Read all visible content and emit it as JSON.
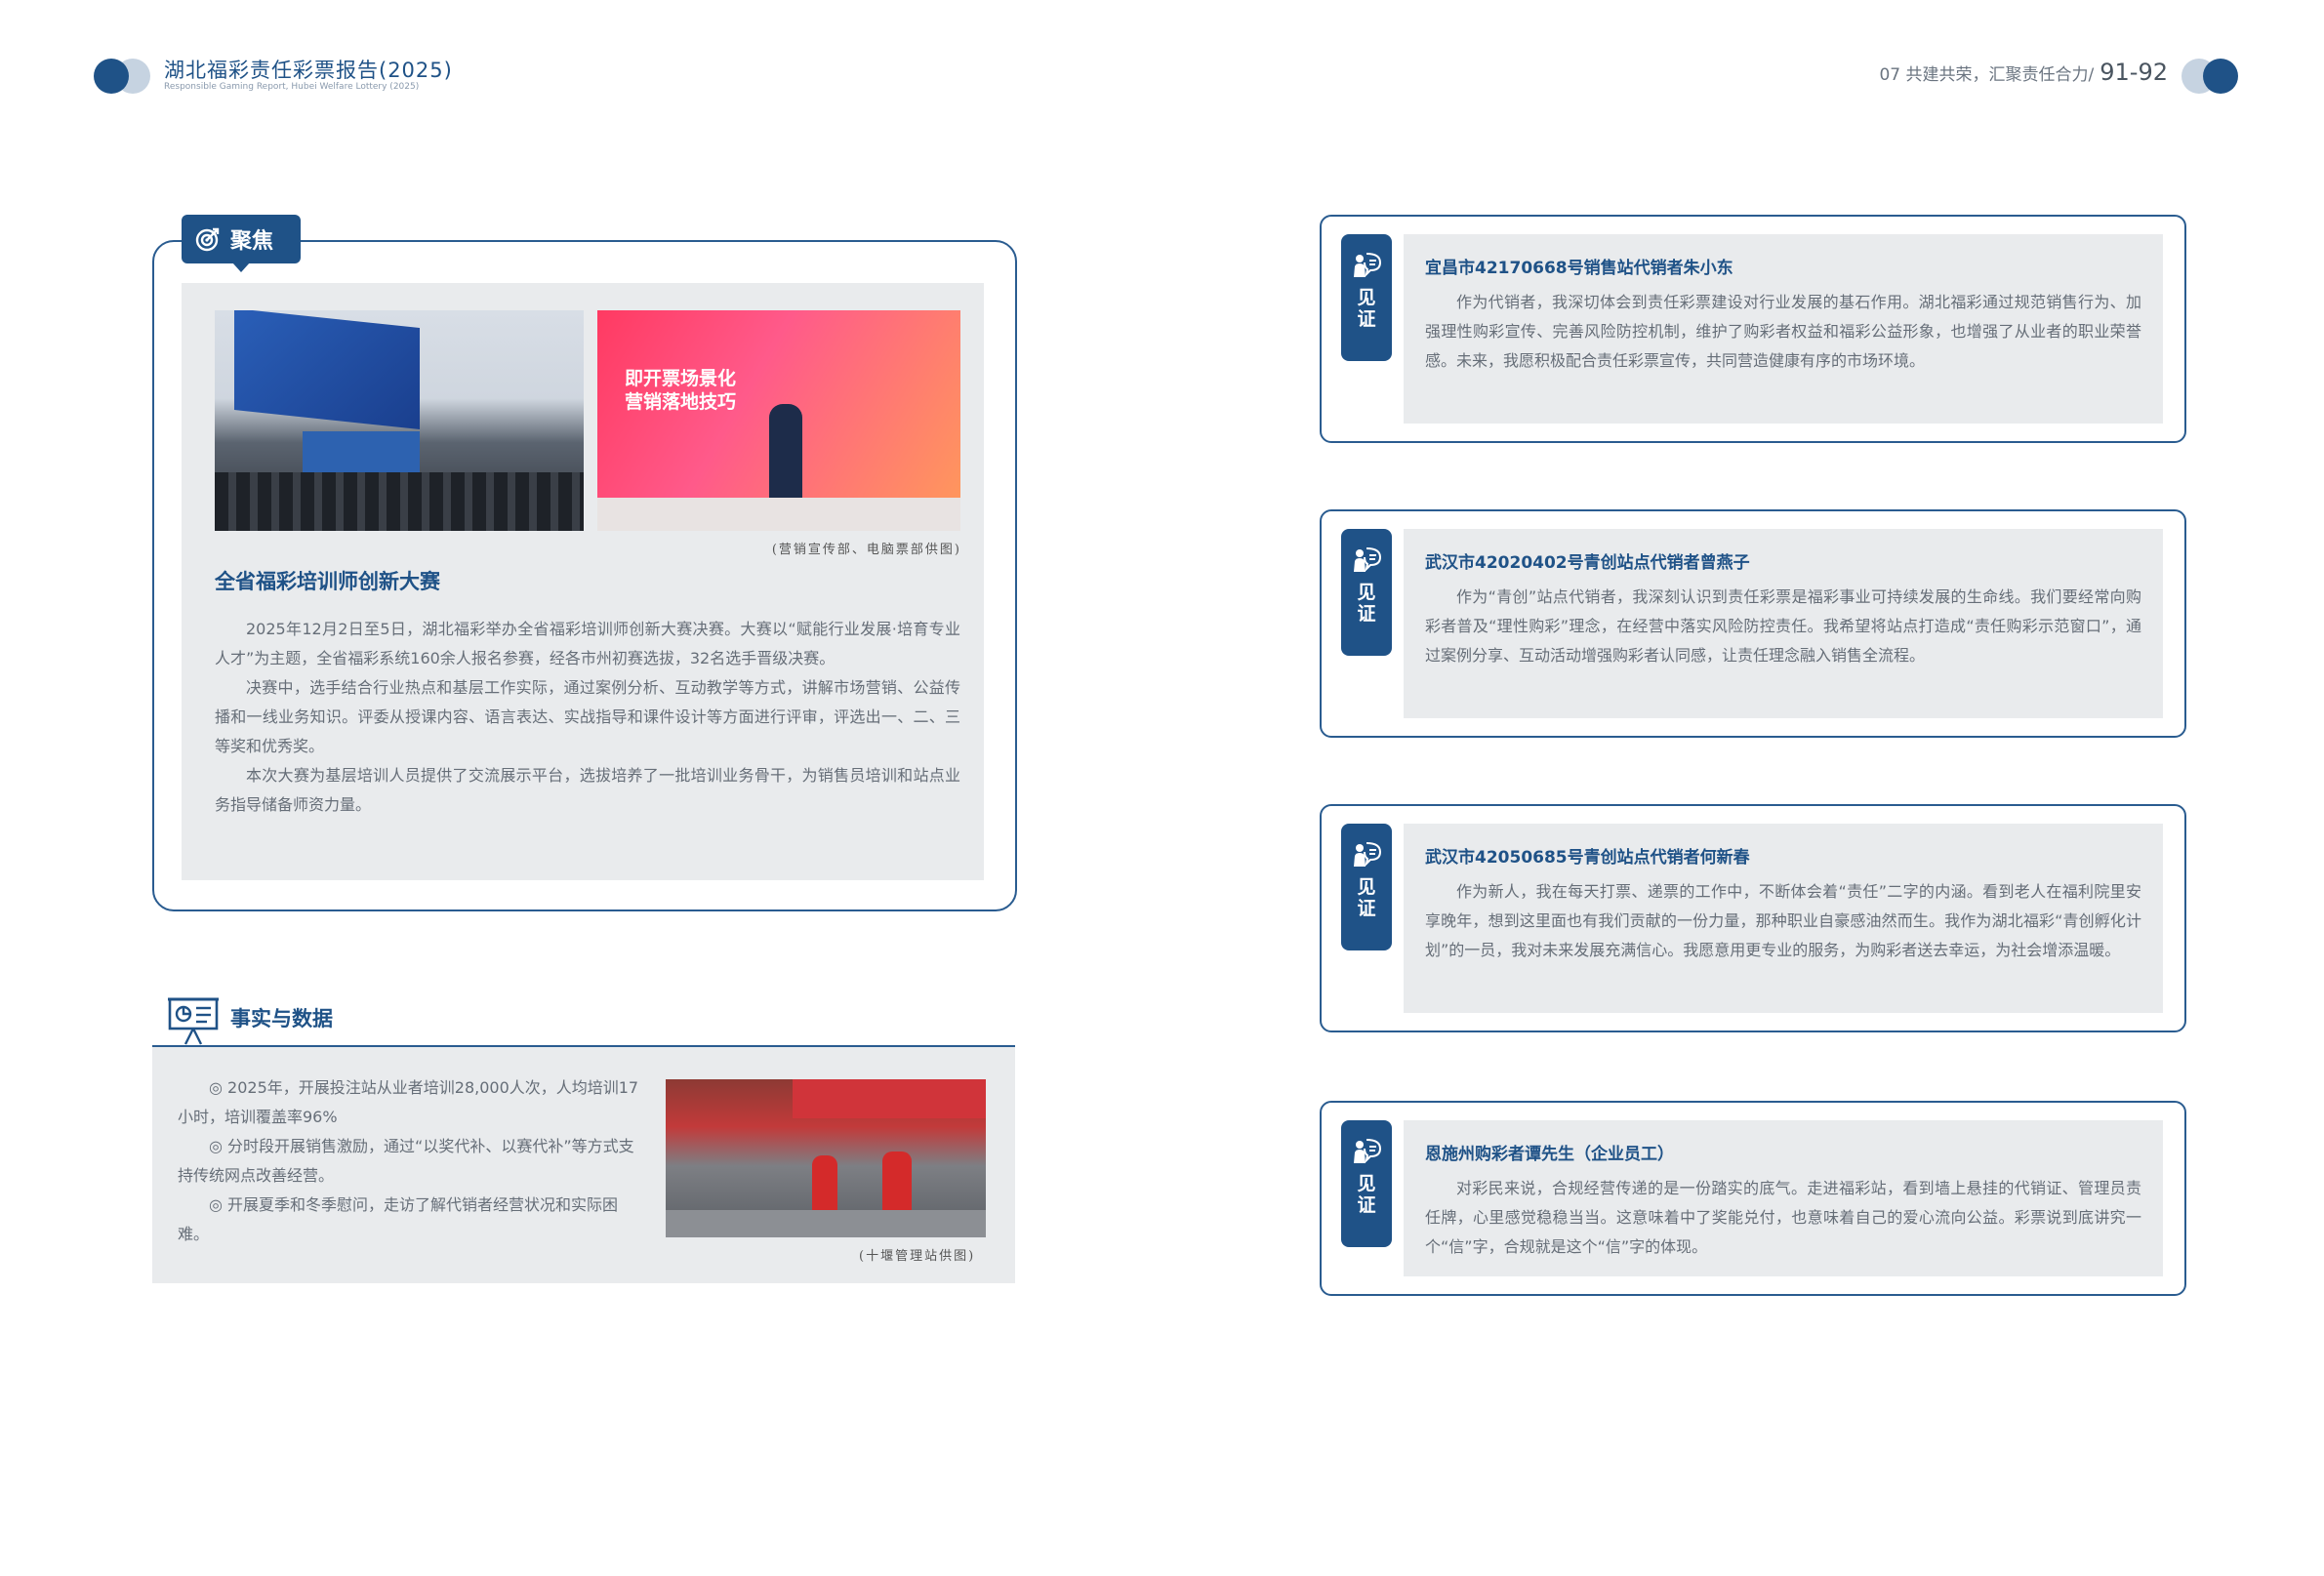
{
  "header": {
    "title": "湖北福彩责任彩票报告(2025)",
    "subtitle": "Responsible Gaming Report, Hubei Welfare Lottery (2025)",
    "chapter": "07 共建共荣，汇聚责任合力/",
    "pages": "91-92"
  },
  "focus": {
    "tag": "聚焦",
    "photo_text": "即开票场景化\n营销落地技巧",
    "photo_caption": "(营销宣传部、电脑票部供图)",
    "title": "全省福彩培训师创新大赛",
    "paragraphs": [
      "2025年12月2日至5日，湖北福彩举办全省福彩培训师创新大赛决赛。大赛以“赋能行业发展·培育专业人才”为主题，全省福彩系统160余人报名参赛，经各市州初赛选拔，32名选手晋级决赛。",
      "决赛中，选手结合行业热点和基层工作实际，通过案例分析、互动教学等方式，讲解市场营销、公益传播和一线业务知识。评委从授课内容、语言表达、实战指导和课件设计等方面进行评审，评选出一、二、三等奖和优秀奖。",
      "本次大赛为基层培训人员提供了交流展示平台，选拔培养了一批培训业务骨干，为销售员培训和站点业务指导储备师资力量。"
    ]
  },
  "facts": {
    "title": "事实与数据",
    "items": [
      "◎ 2025年，开展投注站从业者培训28,000人次，人均培训17小时，培训覆盖率96%",
      "◎ 分时段开展销售激励，通过“以奖代补、以赛代补”等方式支持传统网点改善经营。",
      "◎ 开展夏季和冬季慰问，走访了解代销者经营状况和实际困难。"
    ],
    "photo_caption": "(十堰管理站供图)"
  },
  "witness": {
    "badge": "见证",
    "cards": [
      {
        "title": "宜昌市42170668号销售站代销者朱小东",
        "body": "作为代销者，我深切体会到责任彩票建设对行业发展的基石作用。湖北福彩通过规范销售行为、加强理性购彩宣传、完善风险防控机制，维护了购彩者权益和福彩公益形象，也增强了从业者的职业荣誉感。未来，我愿积极配合责任彩票宣传，共同营造健康有序的市场环境。"
      },
      {
        "title": "武汉市42020402号青创站点代销者曾燕子",
        "body": "作为“青创”站点代销者，我深刻认识到责任彩票是福彩事业可持续发展的生命线。我们要经常向购彩者普及“理性购彩”理念，在经营中落实风险防控责任。我希望将站点打造成“责任购彩示范窗口”，通过案例分享、互动活动增强购彩者认同感，让责任理念融入销售全流程。"
      },
      {
        "title": "武汉市42050685号青创站点代销者何新春",
        "body": "作为新人，我在每天打票、递票的工作中，不断体会着“责任”二字的内涵。看到老人在福利院里安享晚年，想到这里面也有我们贡献的一份力量，那种职业自豪感油然而生。我作为湖北福彩“青创孵化计划”的一员，我对未来发展充满信心。我愿意用更专业的服务，为购彩者送去幸运，为社会增添温暖。"
      },
      {
        "title": "恩施州购彩者谭先生（企业员工）",
        "body": "对彩民来说，合规经营传递的是一份踏实的底气。走进福彩站，看到墙上悬挂的代销证、管理员责任牌，心里感觉稳稳当当。这意味着中了奖能兑付，也意味着自己的爱心流向公益。彩票说到底讲究一个“信”字，合规就是这个“信”字的体现。"
      }
    ]
  }
}
